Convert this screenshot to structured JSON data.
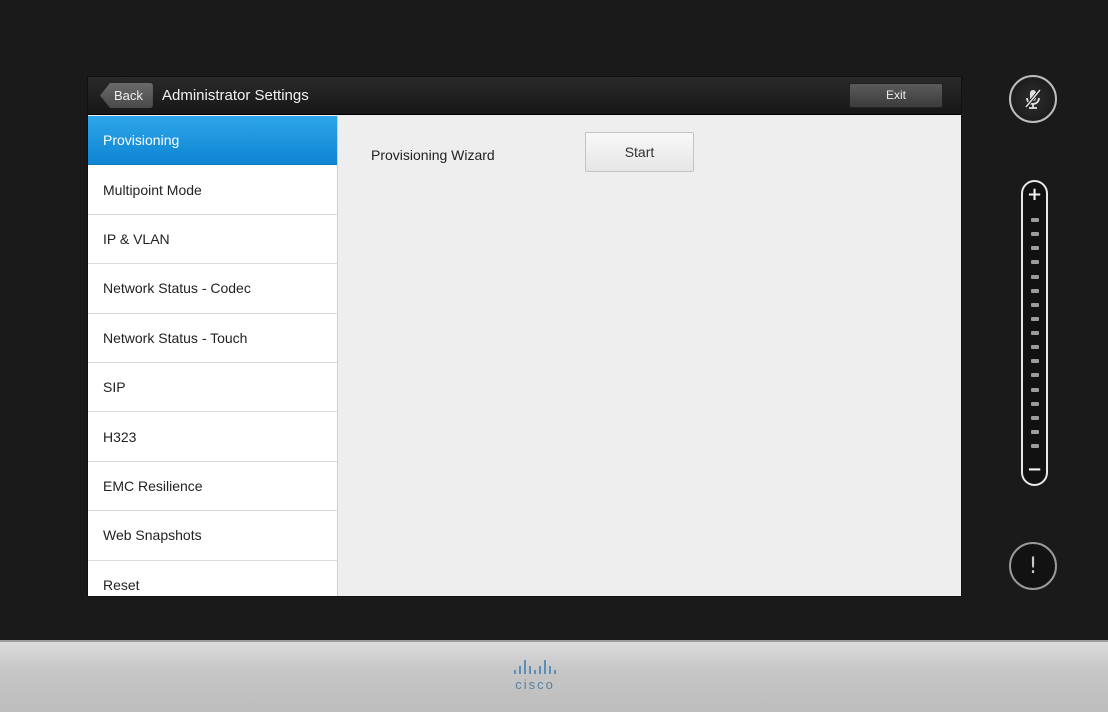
{
  "header": {
    "back_label": "Back",
    "title": "Administrator Settings",
    "exit_label": "Exit"
  },
  "sidebar": {
    "items": [
      {
        "label": "Provisioning",
        "active": true
      },
      {
        "label": "Multipoint Mode"
      },
      {
        "label": "IP & VLAN"
      },
      {
        "label": "Network Status - Codec"
      },
      {
        "label": "Network Status - Touch"
      },
      {
        "label": "SIP"
      },
      {
        "label": "H323"
      },
      {
        "label": "EMC Resilience"
      },
      {
        "label": "Web Snapshots"
      },
      {
        "label": "Reset"
      }
    ]
  },
  "main": {
    "wizard_label": "Provisioning Wizard",
    "start_label": "Start"
  },
  "side_controls": {
    "mute_icon": "microphone-muted-icon",
    "volume_plus": "+",
    "volume_minus": "−",
    "alert_symbol": "!"
  },
  "bezel": {
    "brand": "cisco"
  },
  "colors": {
    "accent": "#1a94df",
    "header_bg": "#1e1e1e"
  }
}
